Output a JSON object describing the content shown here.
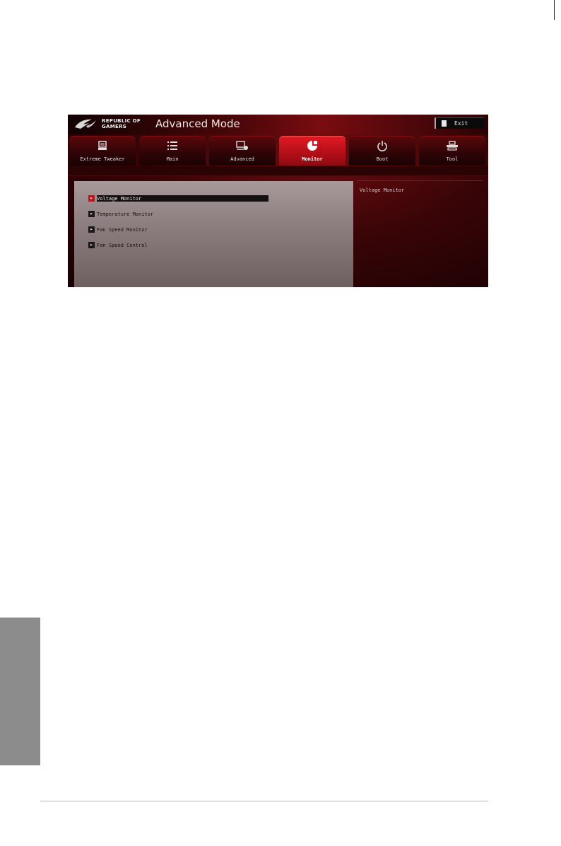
{
  "bios": {
    "logo": {
      "line1": "REPUBLIC OF",
      "line2": "GAMERS"
    },
    "mode_title": "Advanced Mode",
    "exit_label": "Exit",
    "tabs": [
      {
        "label": "Extreme Tweaker",
        "icon": "tweaker-icon",
        "active": false
      },
      {
        "label": "Main",
        "icon": "list-icon",
        "active": false
      },
      {
        "label": "Advanced",
        "icon": "advanced-icon",
        "active": false
      },
      {
        "label": "Monitor",
        "icon": "monitor-icon",
        "active": true
      },
      {
        "label": "Boot",
        "icon": "power-icon",
        "active": false
      },
      {
        "label": "Tool",
        "icon": "tool-icon",
        "active": false
      }
    ],
    "menu": [
      {
        "label": "Voltage Monitor",
        "selected": true
      },
      {
        "label": "Temperature Monitor",
        "selected": false
      },
      {
        "label": "Fan Speed Monitor",
        "selected": false
      },
      {
        "label": "Fan Speed Control",
        "selected": false
      }
    ],
    "help_text": "Voltage Monitor"
  },
  "colors": {
    "accent": "#c0121a",
    "background_dark": "#2a0305",
    "page": "#ffffff",
    "side_tab": "#8c8c8c"
  }
}
